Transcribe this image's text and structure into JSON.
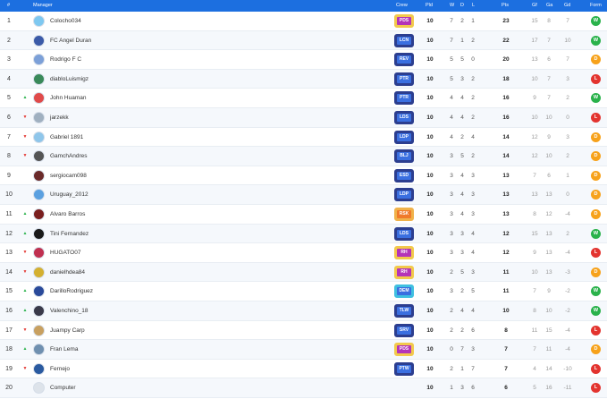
{
  "header": {
    "pos": "#",
    "manager": "Manager",
    "crew": "Crew",
    "pld": "Pld",
    "w": "W",
    "d": "D",
    "l": "L",
    "pts": "Pts",
    "gf": "Gf",
    "ga": "Ga",
    "gd": "Gd",
    "form": "Form"
  },
  "colors": {
    "header_bg": "#1c6fe0",
    "win": "#2ab24b",
    "draw": "#f7a21b",
    "loss": "#e3342f"
  },
  "rows": [
    {
      "pos": "1",
      "trend": "",
      "manager": "Colocho034",
      "avatar": "#7ec8f0",
      "crew": "PDS",
      "crew_bg": "#b434b8",
      "crew_border": "#f2c94c",
      "pld": "10",
      "w": "7",
      "d": "2",
      "l": "1",
      "pts": "23",
      "gf": "15",
      "ga": "8",
      "gd": "7",
      "form": "W"
    },
    {
      "pos": "2",
      "trend": "",
      "manager": "FC Angel Duran",
      "avatar": "#3b5aa8",
      "crew": "LCN",
      "crew_bg": "#3a6fe0",
      "crew_border": "#2c3e8f",
      "pld": "10",
      "w": "7",
      "d": "1",
      "l": "2",
      "pts": "22",
      "gf": "17",
      "ga": "7",
      "gd": "10",
      "form": "W"
    },
    {
      "pos": "3",
      "trend": "",
      "manager": "Rodrigo F C",
      "avatar": "#7ca0d8",
      "crew": "REV",
      "crew_bg": "#3a6fe0",
      "crew_border": "#2c3e8f",
      "pld": "10",
      "w": "5",
      "d": "5",
      "l": "0",
      "pts": "20",
      "gf": "13",
      "ga": "6",
      "gd": "7",
      "form": "D"
    },
    {
      "pos": "4",
      "trend": "",
      "manager": "diabloLuismigz",
      "avatar": "#3a8a5a",
      "crew": "PTR",
      "crew_bg": "#3a6fe0",
      "crew_border": "#2c3e8f",
      "pld": "10",
      "w": "5",
      "d": "3",
      "l": "2",
      "pts": "18",
      "gf": "10",
      "ga": "7",
      "gd": "3",
      "form": "L"
    },
    {
      "pos": "5",
      "trend": "up",
      "manager": "John Huaman",
      "avatar": "#e04a4a",
      "crew": "PTR",
      "crew_bg": "#3a6fe0",
      "crew_border": "#2c3e8f",
      "pld": "10",
      "w": "4",
      "d": "4",
      "l": "2",
      "pts": "16",
      "gf": "9",
      "ga": "7",
      "gd": "2",
      "form": "W"
    },
    {
      "pos": "6",
      "trend": "down",
      "manager": "jarzekk",
      "avatar": "#a0b0c0",
      "crew": "LDS",
      "crew_bg": "#3a6fe0",
      "crew_border": "#2c3e8f",
      "pld": "10",
      "w": "4",
      "d": "4",
      "l": "2",
      "pts": "16",
      "gf": "10",
      "ga": "10",
      "gd": "0",
      "form": "L"
    },
    {
      "pos": "7",
      "trend": "down",
      "manager": "Gabriel 1891",
      "avatar": "#8fc6ea",
      "crew": "LDP",
      "crew_bg": "#3a6fe0",
      "crew_border": "#2c3e8f",
      "pld": "10",
      "w": "4",
      "d": "2",
      "l": "4",
      "pts": "14",
      "gf": "12",
      "ga": "9",
      "gd": "3",
      "form": "D"
    },
    {
      "pos": "8",
      "trend": "down",
      "manager": "GamchAndres",
      "avatar": "#555555",
      "crew": "BLJ",
      "crew_bg": "#3a6fe0",
      "crew_border": "#2c3e8f",
      "pld": "10",
      "w": "3",
      "d": "5",
      "l": "2",
      "pts": "14",
      "gf": "12",
      "ga": "10",
      "gd": "2",
      "form": "D"
    },
    {
      "pos": "9",
      "trend": "",
      "manager": "sergiocam098",
      "avatar": "#6a2a2a",
      "crew": "ESD",
      "crew_bg": "#3a6fe0",
      "crew_border": "#2c3e8f",
      "pld": "10",
      "w": "3",
      "d": "4",
      "l": "3",
      "pts": "13",
      "gf": "7",
      "ga": "6",
      "gd": "1",
      "form": "D"
    },
    {
      "pos": "10",
      "trend": "",
      "manager": "Uruguay_2012",
      "avatar": "#5aa0e0",
      "crew": "LDP",
      "crew_bg": "#3a6fe0",
      "crew_border": "#2c3e8f",
      "pld": "10",
      "w": "3",
      "d": "4",
      "l": "3",
      "pts": "13",
      "gf": "13",
      "ga": "13",
      "gd": "0",
      "form": "D"
    },
    {
      "pos": "11",
      "trend": "up",
      "manager": "Alvaro Barros",
      "avatar": "#7a1f1f",
      "crew": "RSK",
      "crew_bg": "#f07a2a",
      "crew_border": "#f0b24a",
      "pld": "10",
      "w": "3",
      "d": "4",
      "l": "3",
      "pts": "13",
      "gf": "8",
      "ga": "12",
      "gd": "-4",
      "form": "D"
    },
    {
      "pos": "12",
      "trend": "up",
      "manager": "Tini Fernandez",
      "avatar": "#1a1a1a",
      "crew": "LDS",
      "crew_bg": "#3a6fe0",
      "crew_border": "#2c3e8f",
      "pld": "10",
      "w": "3",
      "d": "3",
      "l": "4",
      "pts": "12",
      "gf": "15",
      "ga": "13",
      "gd": "2",
      "form": "W"
    },
    {
      "pos": "13",
      "trend": "down",
      "manager": "HUGATO07",
      "avatar": "#c03050",
      "crew": "RH",
      "crew_bg": "#b434b8",
      "crew_border": "#f2c94c",
      "pld": "10",
      "w": "3",
      "d": "3",
      "l": "4",
      "pts": "12",
      "gf": "9",
      "ga": "13",
      "gd": "-4",
      "form": "L"
    },
    {
      "pos": "14",
      "trend": "down",
      "manager": "danielhdea84",
      "avatar": "#d4b030",
      "crew": "RH",
      "crew_bg": "#b434b8",
      "crew_border": "#f2c94c",
      "pld": "10",
      "w": "2",
      "d": "5",
      "l": "3",
      "pts": "11",
      "gf": "10",
      "ga": "13",
      "gd": "-3",
      "form": "D"
    },
    {
      "pos": "15",
      "trend": "up",
      "manager": "DarilloRodriguez",
      "avatar": "#2a4a9a",
      "crew": "DEM",
      "crew_bg": "#3a6fe0",
      "crew_border": "#40c0e0",
      "pld": "10",
      "w": "3",
      "d": "2",
      "l": "5",
      "pts": "11",
      "gf": "7",
      "ga": "9",
      "gd": "-2",
      "form": "W"
    },
    {
      "pos": "16",
      "trend": "up",
      "manager": "Valenchino_18",
      "avatar": "#3a3a4a",
      "crew": "TLW",
      "crew_bg": "#3a6fe0",
      "crew_border": "#2c3e8f",
      "pld": "10",
      "w": "2",
      "d": "4",
      "l": "4",
      "pts": "10",
      "gf": "8",
      "ga": "10",
      "gd": "-2",
      "form": "W"
    },
    {
      "pos": "17",
      "trend": "down",
      "manager": "Juampy Carp",
      "avatar": "#c8a060",
      "crew": "SRV",
      "crew_bg": "#3a6fe0",
      "crew_border": "#2c3e8f",
      "pld": "10",
      "w": "2",
      "d": "2",
      "l": "6",
      "pts": "8",
      "gf": "11",
      "ga": "15",
      "gd": "-4",
      "form": "L"
    },
    {
      "pos": "18",
      "trend": "up",
      "manager": "Fran Lema",
      "avatar": "#7090b0",
      "crew": "PDS",
      "crew_bg": "#b434b8",
      "crew_border": "#f2c94c",
      "pld": "10",
      "w": "0",
      "d": "7",
      "l": "3",
      "pts": "7",
      "gf": "7",
      "ga": "11",
      "gd": "-4",
      "form": "D"
    },
    {
      "pos": "19",
      "trend": "down",
      "manager": "Fernejo",
      "avatar": "#2a5aa0",
      "crew": "PTW",
      "crew_bg": "#3a6fe0",
      "crew_border": "#2c3e8f",
      "pld": "10",
      "w": "2",
      "d": "1",
      "l": "7",
      "pts": "7",
      "gf": "4",
      "ga": "14",
      "gd": "-10",
      "form": "L"
    },
    {
      "pos": "20",
      "trend": "",
      "manager": "Computer",
      "avatar": "#dde3ea",
      "crew": "",
      "crew_bg": "",
      "crew_border": "",
      "pld": "10",
      "w": "1",
      "d": "3",
      "l": "6",
      "pts": "6",
      "gf": "5",
      "ga": "16",
      "gd": "-11",
      "form": "L"
    }
  ]
}
